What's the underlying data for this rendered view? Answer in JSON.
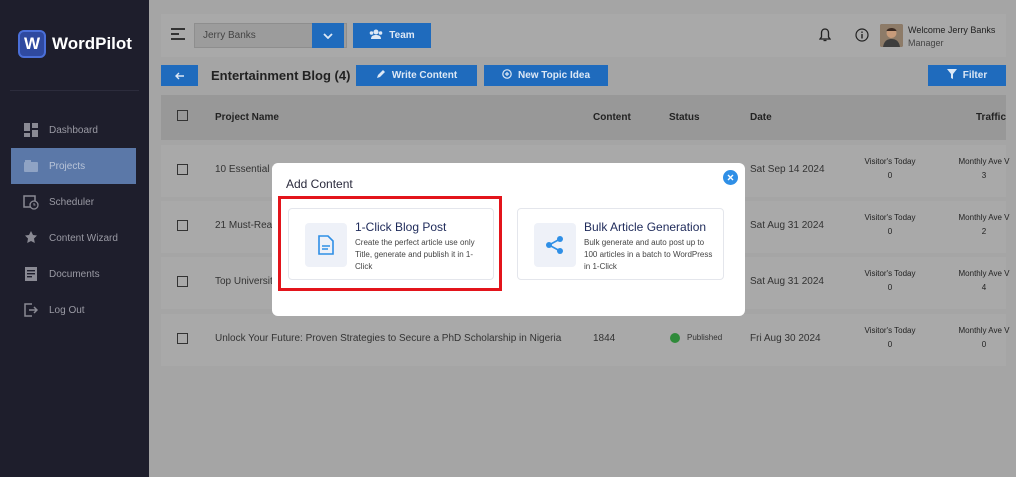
{
  "app": {
    "logo_letter": "W",
    "name": "WordPilot"
  },
  "sidebar": {
    "items": [
      {
        "label": "Dashboard",
        "icon": "dashboard-icon"
      },
      {
        "label": "Projects",
        "icon": "projects-icon",
        "active": true
      },
      {
        "label": "Scheduler",
        "icon": "calendar-icon"
      },
      {
        "label": "Content Wizard",
        "icon": "wizard-icon"
      },
      {
        "label": "Documents",
        "icon": "document-icon"
      },
      {
        "label": "Log Out",
        "icon": "logout-icon"
      }
    ]
  },
  "topbar": {
    "user_select_value": "Jerry Banks",
    "team_label": "Team",
    "welcome": "Welcome Jerry Banks",
    "role": "Manager"
  },
  "subbar": {
    "blog_title": "Entertainment Blog (4)",
    "write_label": "Write Content",
    "topic_label": "New Topic Idea",
    "filter_label": "Filter"
  },
  "table": {
    "headers": {
      "project": "Project Name",
      "content": "Content",
      "status": "Status",
      "date": "Date",
      "traffic": "Traffic"
    },
    "rows": [
      {
        "name": "10 Essential P",
        "content": "",
        "status": "",
        "date": "Sat Sep 14 2024",
        "vt_label": "Visitor's Today",
        "vt_value": "0",
        "ma_label": "Monthly Ave V",
        "ma_value": "3"
      },
      {
        "name": "21 Must-Read",
        "content": "",
        "status": "",
        "date": "Sat Aug 31 2024",
        "vt_label": "Visitor's Today",
        "vt_value": "0",
        "ma_label": "Monthly Ave V",
        "ma_value": "2"
      },
      {
        "name": "Top Universit",
        "content": "",
        "status": "",
        "date": "Sat Aug 31 2024",
        "vt_label": "Visitor's Today",
        "vt_value": "0",
        "ma_label": "Monthly Ave V",
        "ma_value": "4"
      },
      {
        "name": "Unlock Your Future: Proven Strategies to Secure a PhD Scholarship in Nigeria",
        "content": "1844",
        "status": "Published",
        "date": "Fri Aug 30 2024",
        "vt_label": "Visitor's Today",
        "vt_value": "0",
        "ma_label": "Monthly Ave V",
        "ma_value": "0"
      }
    ]
  },
  "modal": {
    "title": "Add Content",
    "cards": [
      {
        "title": "1-Click Blog Post",
        "desc": "Create the perfect article use only Title, generate and publish it in 1-Click",
        "icon": "document-icon"
      },
      {
        "title": "Bulk Article Generation",
        "desc": "Bulk generate and auto post up to 100 articles in a batch to WordPress in 1-Click",
        "icon": "share-icon"
      }
    ]
  },
  "colors": {
    "accent": "#1f6bbd",
    "highlight": "#e3141b",
    "sidebar": "#1e1e2c"
  }
}
